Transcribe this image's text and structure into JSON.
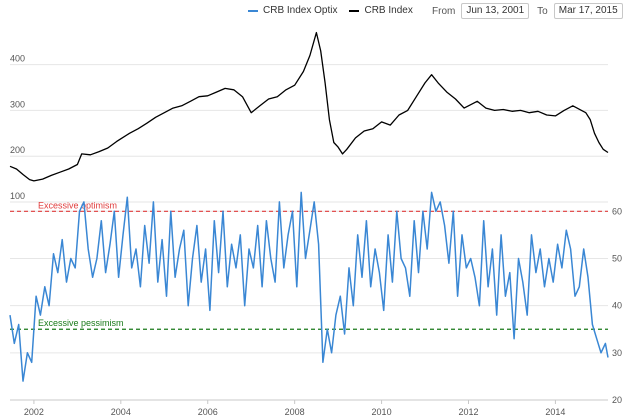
{
  "legend": [
    {
      "label": "CRB Index Optix",
      "color": "#3a87d4"
    },
    {
      "label": "CRB Index",
      "color": "#000000"
    }
  ],
  "range": {
    "from_label": "From",
    "from_value": "Jun 13, 2001",
    "to_label": "To",
    "to_value": "Mar 17, 2015"
  },
  "chart_data": [
    {
      "type": "line",
      "title": "",
      "series": [
        {
          "name": "CRB Index",
          "color": "#000000"
        }
      ],
      "yticks": [
        100,
        200,
        300,
        400
      ],
      "ylim": [
        100,
        480
      ],
      "xlim": [
        2001.45,
        2015.21
      ],
      "grid": true,
      "x": [
        2001.45,
        2001.6,
        2001.75,
        2001.9,
        2002.0,
        2002.2,
        2002.4,
        2002.6,
        2002.8,
        2003.0,
        2003.1,
        2003.3,
        2003.5,
        2003.7,
        2003.9,
        2004.0,
        2004.2,
        2004.4,
        2004.6,
        2004.8,
        2005.0,
        2005.2,
        2005.4,
        2005.6,
        2005.8,
        2006.0,
        2006.2,
        2006.4,
        2006.6,
        2006.8,
        2007.0,
        2007.2,
        2007.4,
        2007.6,
        2007.8,
        2008.0,
        2008.2,
        2008.35,
        2008.5,
        2008.6,
        2008.7,
        2008.8,
        2008.9,
        2009.0,
        2009.1,
        2009.2,
        2009.4,
        2009.6,
        2009.8,
        2010.0,
        2010.2,
        2010.4,
        2010.6,
        2010.8,
        2011.0,
        2011.15,
        2011.3,
        2011.5,
        2011.7,
        2011.9,
        2012.0,
        2012.2,
        2012.4,
        2012.6,
        2012.8,
        2013.0,
        2013.2,
        2013.4,
        2013.6,
        2013.8,
        2014.0,
        2014.2,
        2014.4,
        2014.5,
        2014.6,
        2014.7,
        2014.8,
        2014.9,
        2015.0,
        2015.1,
        2015.21
      ],
      "values": [
        178,
        172,
        160,
        149,
        146,
        150,
        158,
        165,
        172,
        182,
        205,
        203,
        210,
        218,
        232,
        238,
        250,
        260,
        272,
        285,
        295,
        305,
        310,
        320,
        330,
        332,
        340,
        348,
        345,
        330,
        295,
        310,
        325,
        330,
        345,
        355,
        385,
        420,
        470,
        430,
        360,
        280,
        230,
        220,
        205,
        215,
        240,
        255,
        260,
        275,
        268,
        290,
        300,
        330,
        360,
        378,
        360,
        340,
        325,
        305,
        310,
        320,
        305,
        300,
        302,
        298,
        300,
        295,
        298,
        290,
        288,
        300,
        310,
        305,
        300,
        295,
        280,
        250,
        230,
        215,
        208
      ]
    },
    {
      "type": "line",
      "series": [
        {
          "name": "CRB Index Optix",
          "color": "#3a87d4"
        }
      ],
      "yticks": [
        20,
        30,
        40,
        50,
        60
      ],
      "ylim": [
        20,
        66
      ],
      "xticks": [
        "2002",
        "2004",
        "2006",
        "2008",
        "2010",
        "2012",
        "2014"
      ],
      "xlim": [
        2001.45,
        2015.21
      ],
      "grid": true,
      "annotations": [
        {
          "text": "Excessive optimism",
          "y": 60,
          "color": "#e03c3c"
        },
        {
          "text": "Excessive pessimism",
          "y": 35,
          "color": "#1a7a1a"
        }
      ],
      "x": [
        2001.45,
        2001.55,
        2001.65,
        2001.75,
        2001.85,
        2001.95,
        2002.05,
        2002.15,
        2002.25,
        2002.35,
        2002.45,
        2002.55,
        2002.65,
        2002.75,
        2002.85,
        2002.95,
        2003.05,
        2003.15,
        2003.25,
        2003.35,
        2003.45,
        2003.55,
        2003.65,
        2003.75,
        2003.85,
        2003.95,
        2004.05,
        2004.15,
        2004.25,
        2004.35,
        2004.45,
        2004.55,
        2004.65,
        2004.75,
        2004.85,
        2004.95,
        2005.05,
        2005.15,
        2005.25,
        2005.35,
        2005.45,
        2005.55,
        2005.65,
        2005.75,
        2005.85,
        2005.95,
        2006.05,
        2006.15,
        2006.25,
        2006.35,
        2006.45,
        2006.55,
        2006.65,
        2006.75,
        2006.85,
        2006.95,
        2007.05,
        2007.15,
        2007.25,
        2007.35,
        2007.45,
        2007.55,
        2007.65,
        2007.75,
        2007.85,
        2007.95,
        2008.05,
        2008.15,
        2008.25,
        2008.35,
        2008.45,
        2008.55,
        2008.65,
        2008.75,
        2008.85,
        2008.95,
        2009.05,
        2009.15,
        2009.25,
        2009.35,
        2009.45,
        2009.55,
        2009.65,
        2009.75,
        2009.85,
        2009.95,
        2010.05,
        2010.15,
        2010.25,
        2010.35,
        2010.45,
        2010.55,
        2010.65,
        2010.75,
        2010.85,
        2010.95,
        2011.05,
        2011.15,
        2011.25,
        2011.35,
        2011.45,
        2011.55,
        2011.65,
        2011.75,
        2011.85,
        2011.95,
        2012.05,
        2012.15,
        2012.25,
        2012.35,
        2012.45,
        2012.55,
        2012.65,
        2012.75,
        2012.85,
        2012.95,
        2013.05,
        2013.15,
        2013.25,
        2013.35,
        2013.45,
        2013.55,
        2013.65,
        2013.75,
        2013.85,
        2013.95,
        2014.05,
        2014.15,
        2014.25,
        2014.35,
        2014.45,
        2014.55,
        2014.65,
        2014.75,
        2014.85,
        2014.95,
        2015.05,
        2015.15,
        2015.21
      ],
      "values": [
        38,
        32,
        36,
        24,
        30,
        28,
        42,
        38,
        44,
        40,
        51,
        47,
        54,
        45,
        50,
        48,
        60,
        62,
        52,
        46,
        50,
        58,
        47,
        53,
        60,
        46,
        55,
        63,
        48,
        52,
        44,
        57,
        49,
        62,
        45,
        54,
        42,
        60,
        46,
        52,
        56,
        40,
        50,
        57,
        45,
        52,
        39,
        58,
        47,
        60,
        44,
        53,
        48,
        55,
        40,
        52,
        48,
        57,
        44,
        58,
        50,
        45,
        62,
        48,
        55,
        60,
        44,
        64,
        50,
        56,
        62,
        53,
        28,
        35,
        30,
        38,
        42,
        34,
        48,
        40,
        55,
        46,
        58,
        44,
        52,
        47,
        39,
        55,
        45,
        60,
        50,
        48,
        42,
        58,
        47,
        60,
        52,
        64,
        60,
        62,
        57,
        49,
        60,
        42,
        55,
        48,
        50,
        46,
        40,
        58,
        44,
        52,
        38,
        55,
        42,
        47,
        33,
        50,
        45,
        38,
        55,
        47,
        52,
        44,
        50,
        45,
        53,
        48,
        56,
        52,
        42,
        44,
        52,
        46,
        36,
        33,
        30,
        32,
        29,
        31,
        28
      ]
    }
  ]
}
